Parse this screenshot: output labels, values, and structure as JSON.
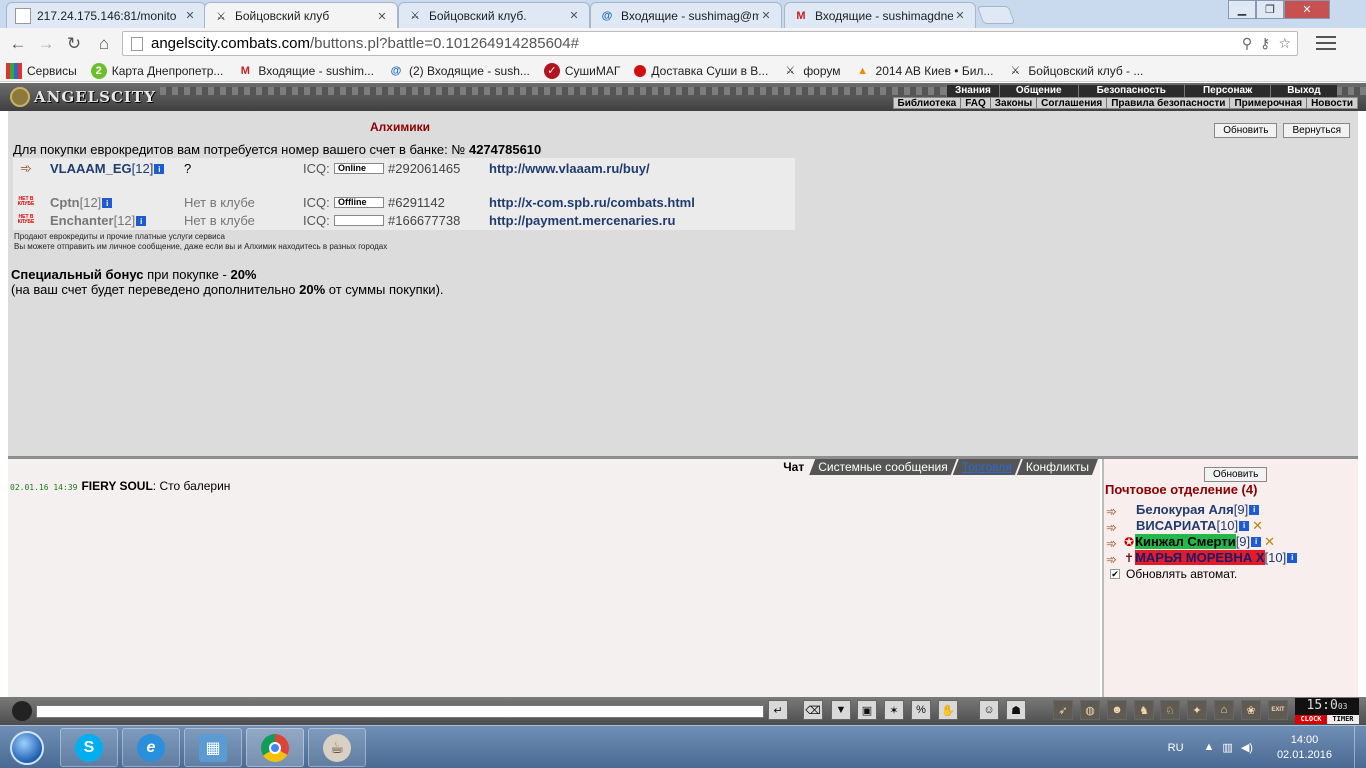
{
  "browser": {
    "tabs": [
      {
        "label": "217.24.175.146:81/monito",
        "icon": "page-icon"
      },
      {
        "label": "Бойцовский клуб",
        "icon": "swords-icon",
        "active": true
      },
      {
        "label": "Бойцовский клуб.",
        "icon": "swords-icon"
      },
      {
        "label": "Входящие - sushimag@m",
        "icon": "mail-at-icon"
      },
      {
        "label": "Входящие - sushimagdne",
        "icon": "gmail-icon"
      }
    ],
    "url_host": "angelscity.combats.com",
    "url_path": "/buttons.pl?battle=0.101264914285604#",
    "bookmarks": [
      {
        "label": "Сервисы",
        "icon": "apps-icon"
      },
      {
        "label": "Карта Днепропетр...",
        "icon": "map-2gis-icon"
      },
      {
        "label": "Входящие - sushim...",
        "icon": "gmail-icon"
      },
      {
        "label": "(2) Входящие - sush...",
        "icon": "mail-at-icon"
      },
      {
        "label": "СушиМАГ",
        "icon": "sushimag-icon"
      },
      {
        "label": "Доставка Суши в В...",
        "icon": "red-dot-icon"
      },
      {
        "label": "форум",
        "icon": "swords-icon"
      },
      {
        "label": "2014 AB Киев • Бил...",
        "icon": "vlc-cone-icon"
      },
      {
        "label": "Бойцовский клуб - ...",
        "icon": "swords-icon"
      }
    ]
  },
  "game": {
    "logo": "ANGELSCITY",
    "topnav": [
      "Знания",
      "Общение",
      "Безопасность",
      "Персонаж",
      "Выход"
    ],
    "subnav": [
      "Библиотека",
      "FAQ",
      "Законы",
      "Соглашения",
      "Правила безопасности",
      "Примерочная",
      "Новости"
    ]
  },
  "alchemists": {
    "title": "Алхимики",
    "refresh_label": "Обновить",
    "back_label": "Вернуться",
    "bank_text": "Для покупки еврокредитов вам потребуется номер вашего счет в банке: №",
    "bank_number": "4274785610",
    "sellers": [
      {
        "name": "VLAAAM_EG",
        "level": "[12]",
        "status": "?",
        "icq_label": "ICQ:",
        "icq_state": "Online",
        "icq": "#292061465",
        "link": "http://www.vlaaam.ru/buy/",
        "online": true
      },
      {
        "name": "Cptn",
        "level": "[12]",
        "status": "Нет в клубе",
        "icq_label": "ICQ:",
        "icq_state": "Offline",
        "icq": "#6291142",
        "link": "http://x-com.spb.ru/combats.html",
        "online": false
      },
      {
        "name": "Enchanter",
        "level": "[12]",
        "status": "Нет в клубе",
        "icq_label": "ICQ:",
        "icq_state": "",
        "icq": "#166677738",
        "link": "http://payment.mercenaries.ru",
        "online": false
      }
    ],
    "offline_badge": "НЕТ В КЛУБЕ",
    "note1": "Продают еврокредиты и прочие платные услуги сервиса",
    "note2": "Вы можете отправить им личное сообщение, даже если вы и Алхимик находитесь в разных городах",
    "bonus_bold": "Специальный бонус",
    "bonus_mid": " при покупке - ",
    "bonus_pct": "20%",
    "bonus2_pre": "(на ваш счет будет переведено дополнительно ",
    "bonus2_pct": "20%",
    "bonus2_post": " от суммы покупки)."
  },
  "chat": {
    "tabs": [
      "Чат",
      "Системные сообщения",
      "Торговля",
      "Конфликты"
    ],
    "messages": [
      {
        "time": "02.01.16 14:39",
        "who": "FIERY SOUL",
        "text": ": Сто балерин"
      }
    ]
  },
  "mail": {
    "refresh_label": "Обновить",
    "title": "Почтовое отделение (4)",
    "items": [
      {
        "name": "Белокурая Аля",
        "level": "[9]"
      },
      {
        "name": "ВИСАРИАТА",
        "level": "[10]"
      },
      {
        "name": "Кинжал Смерти",
        "level": "[9]"
      },
      {
        "name": "МАРЬЯ МОРЕВНА Х",
        "level": "[10]"
      }
    ],
    "auto_label": "Обновлять автомат."
  },
  "clock": {
    "time": "15:0",
    "small": "03",
    "clock_label": "CLOCK",
    "timer_label": "TIMER",
    "exit_label": "EXIT"
  },
  "taskbar": {
    "lang": "RU",
    "time": "14:00",
    "date": "02.01.2016"
  }
}
